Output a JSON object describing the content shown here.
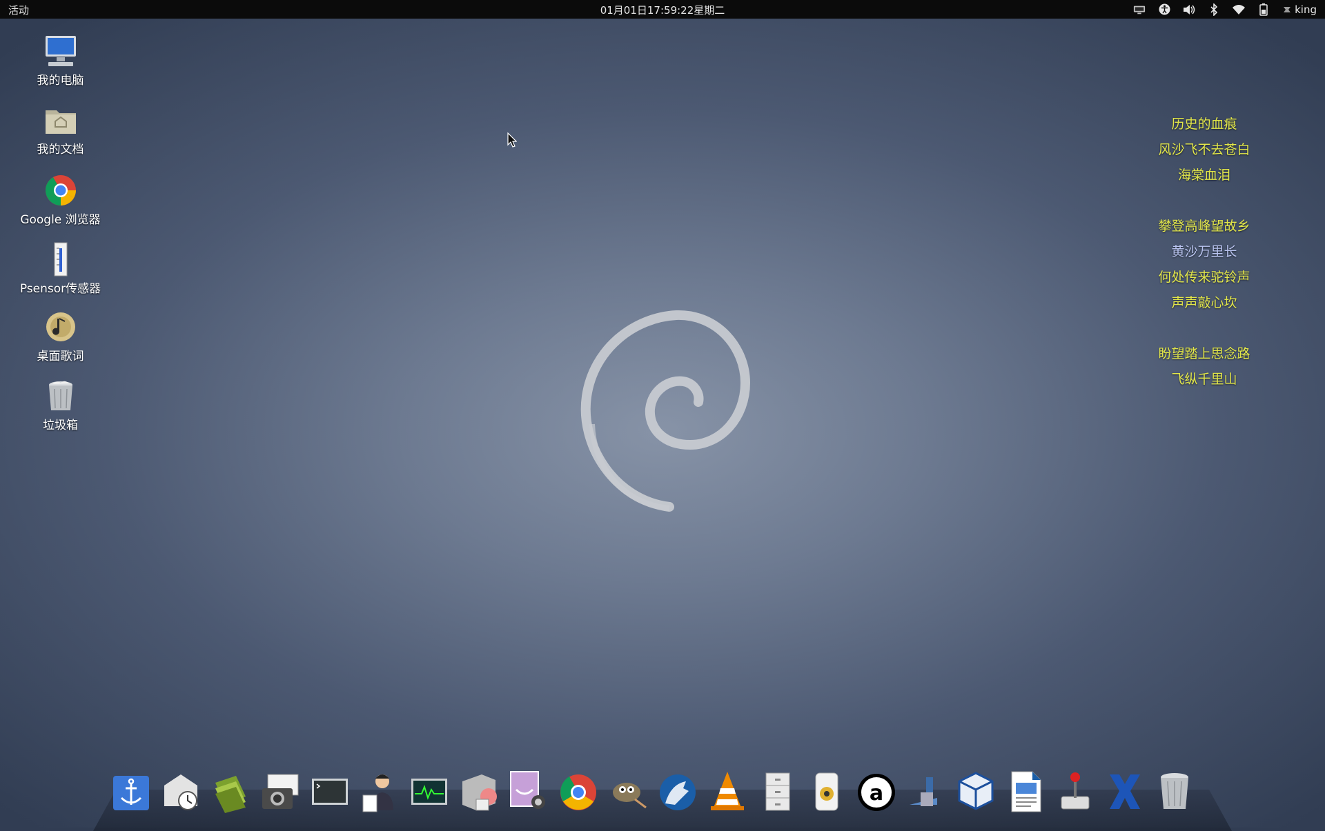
{
  "topbar": {
    "activities": "活动",
    "clock": "01月01日17:59:22星期二",
    "user": "king",
    "tray_icons": [
      "display-icon",
      "accessibility-icon",
      "volume-icon",
      "bluetooth-icon",
      "wifi-icon",
      "battery-icon"
    ]
  },
  "desktop": {
    "icons": [
      {
        "label": "我的电脑",
        "icon": "computer-icon"
      },
      {
        "label": "我的文档",
        "icon": "home-folder-icon"
      },
      {
        "label": "Google 浏览器",
        "icon": "chrome-icon"
      },
      {
        "label": "Psensor传感器",
        "icon": "thermometer-icon"
      },
      {
        "label": "桌面歌词",
        "icon": "lyrics-disc-icon"
      },
      {
        "label": "垃圾箱",
        "icon": "trash-icon"
      }
    ]
  },
  "lyrics": {
    "lines": [
      "历史的血痕",
      "风沙飞不去苍白",
      "海棠血泪",
      "",
      "攀登高峰望故乡",
      "黄沙万里长",
      "何处传来驼铃声",
      "声声敲心坎",
      "",
      "盼望踏上思念路",
      "飞纵千里山"
    ]
  },
  "dock": {
    "items": [
      {
        "name": "anchor-app-icon"
      },
      {
        "name": "mail-clock-icon"
      },
      {
        "name": "books-icon"
      },
      {
        "name": "camera-icon"
      },
      {
        "name": "terminal-icon"
      },
      {
        "name": "user-manager-icon"
      },
      {
        "name": "system-monitor-icon"
      },
      {
        "name": "disc-burner-icon"
      },
      {
        "name": "screenshot-icon"
      },
      {
        "name": "chrome-icon"
      },
      {
        "name": "gimp-icon"
      },
      {
        "name": "wolf-browser-icon"
      },
      {
        "name": "vlc-icon"
      },
      {
        "name": "file-cabinet-icon"
      },
      {
        "name": "speaker-icon"
      },
      {
        "name": "at-sign-icon"
      },
      {
        "name": "film-projector-icon"
      },
      {
        "name": "virtualbox-icon"
      },
      {
        "name": "document-viewer-icon"
      },
      {
        "name": "joystick-icon"
      },
      {
        "name": "x-app-icon"
      },
      {
        "name": "trash-icon"
      }
    ]
  }
}
